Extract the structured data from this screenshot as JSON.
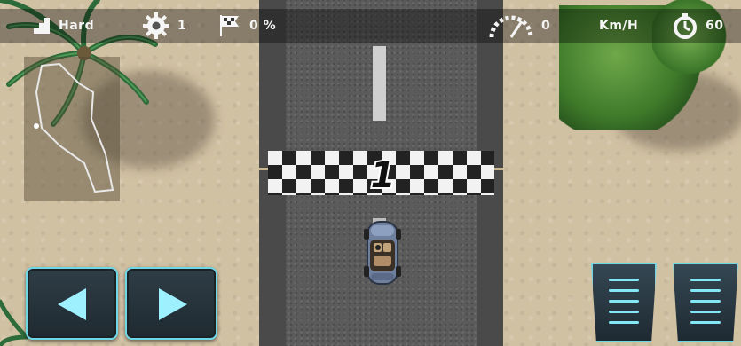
{
  "hud": {
    "difficulty": "Hard",
    "settings_value": "1",
    "progress_value": "0 %",
    "speed_value": "0",
    "speed_unit": "Km/H",
    "timer_value": "60"
  },
  "track": {
    "lap_number": "1"
  },
  "controls": {
    "left_icon": "left-arrow-icon",
    "right_icon": "right-arrow-icon",
    "brake_icon": "brake-pedal-icon",
    "gas_icon": "gas-pedal-icon"
  },
  "colors": {
    "hud_text": "#f5f5f5",
    "control_border": "#6fd6e6",
    "road": "#5b5b5b",
    "sand": "#d1c1a3"
  }
}
